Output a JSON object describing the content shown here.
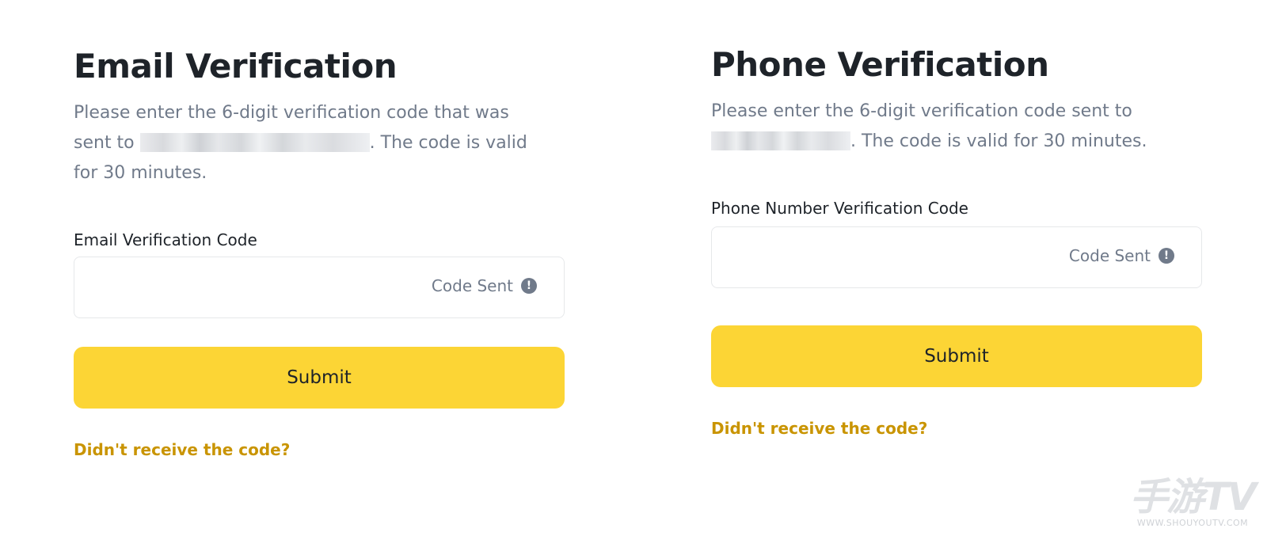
{
  "email": {
    "title": "Email Verification",
    "desc_prefix": "Please enter the 6-digit verification code that was sent to",
    "desc_suffix": ". The code is valid for 30 minutes.",
    "field_label": "Email Verification Code",
    "code_sent": "Code Sent",
    "submit_label": "Submit",
    "resend_link": "Didn't receive the code?"
  },
  "phone": {
    "title": "Phone Verification",
    "desc_prefix": "Please enter the 6-digit verification code sent to",
    "desc_suffix": ". The code is valid for 30 minutes.",
    "field_label": "Phone Number Verification Code",
    "code_sent": "Code Sent",
    "submit_label": "Submit",
    "resend_link": "Didn't receive the code?"
  },
  "icons": {
    "code_sent_icon": "exclamation-circle-icon",
    "warn_glyph": "!"
  },
  "watermark": {
    "logo": "手游TV",
    "url": "WWW.SHOUYOUTV.COM"
  },
  "colors": {
    "accent": "#fcd535",
    "link": "#c99400",
    "text_primary": "#1e2329",
    "text_secondary": "#707a8a"
  }
}
